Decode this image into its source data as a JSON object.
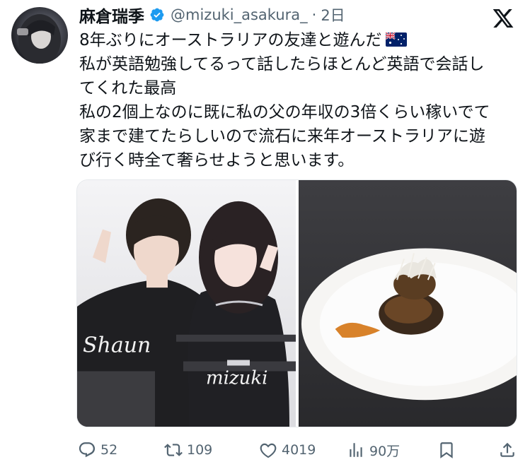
{
  "user": {
    "display_name": "麻倉瑞季",
    "handle": "@mizuki_asakura_",
    "separator": "·",
    "time": "2日",
    "verified_icon": "verified-badge-icon",
    "avatar": "profile-avatar"
  },
  "platform_logo": "x-logo-icon",
  "tweet": {
    "lines": [
      "8年ぶりにオーストラリアの友達と遊んだ",
      "私が英語勉強してるって話したらほとんど英語で会話し",
      "てくれた最高",
      "私の2個上なのに既に私の父の年収の3倍くらい稼いでて",
      "家まで建てたらしいので流石に来年オーストラリアに遊",
      "び行く時全て奢らせようと思います。"
    ],
    "flag_icon": "australia-flag-icon"
  },
  "media": {
    "photo_left": {
      "description_name": "photo-two-people",
      "shirt_left_text": "Shaun",
      "shirt_right_text": "mizuki"
    },
    "photo_right": {
      "description_name": "photo-food-plate"
    }
  },
  "actions": {
    "reply": {
      "icon": "reply-icon",
      "count": "52"
    },
    "retweet": {
      "icon": "retweet-icon",
      "count": "109"
    },
    "like": {
      "icon": "heart-icon",
      "count": "4019"
    },
    "views": {
      "icon": "views-icon",
      "count": "90万"
    },
    "bookmark": {
      "icon": "bookmark-icon"
    },
    "share": {
      "icon": "share-icon"
    }
  },
  "colors": {
    "text": "#0f1419",
    "secondary": "#536471",
    "verified": "#1d9bf0"
  }
}
